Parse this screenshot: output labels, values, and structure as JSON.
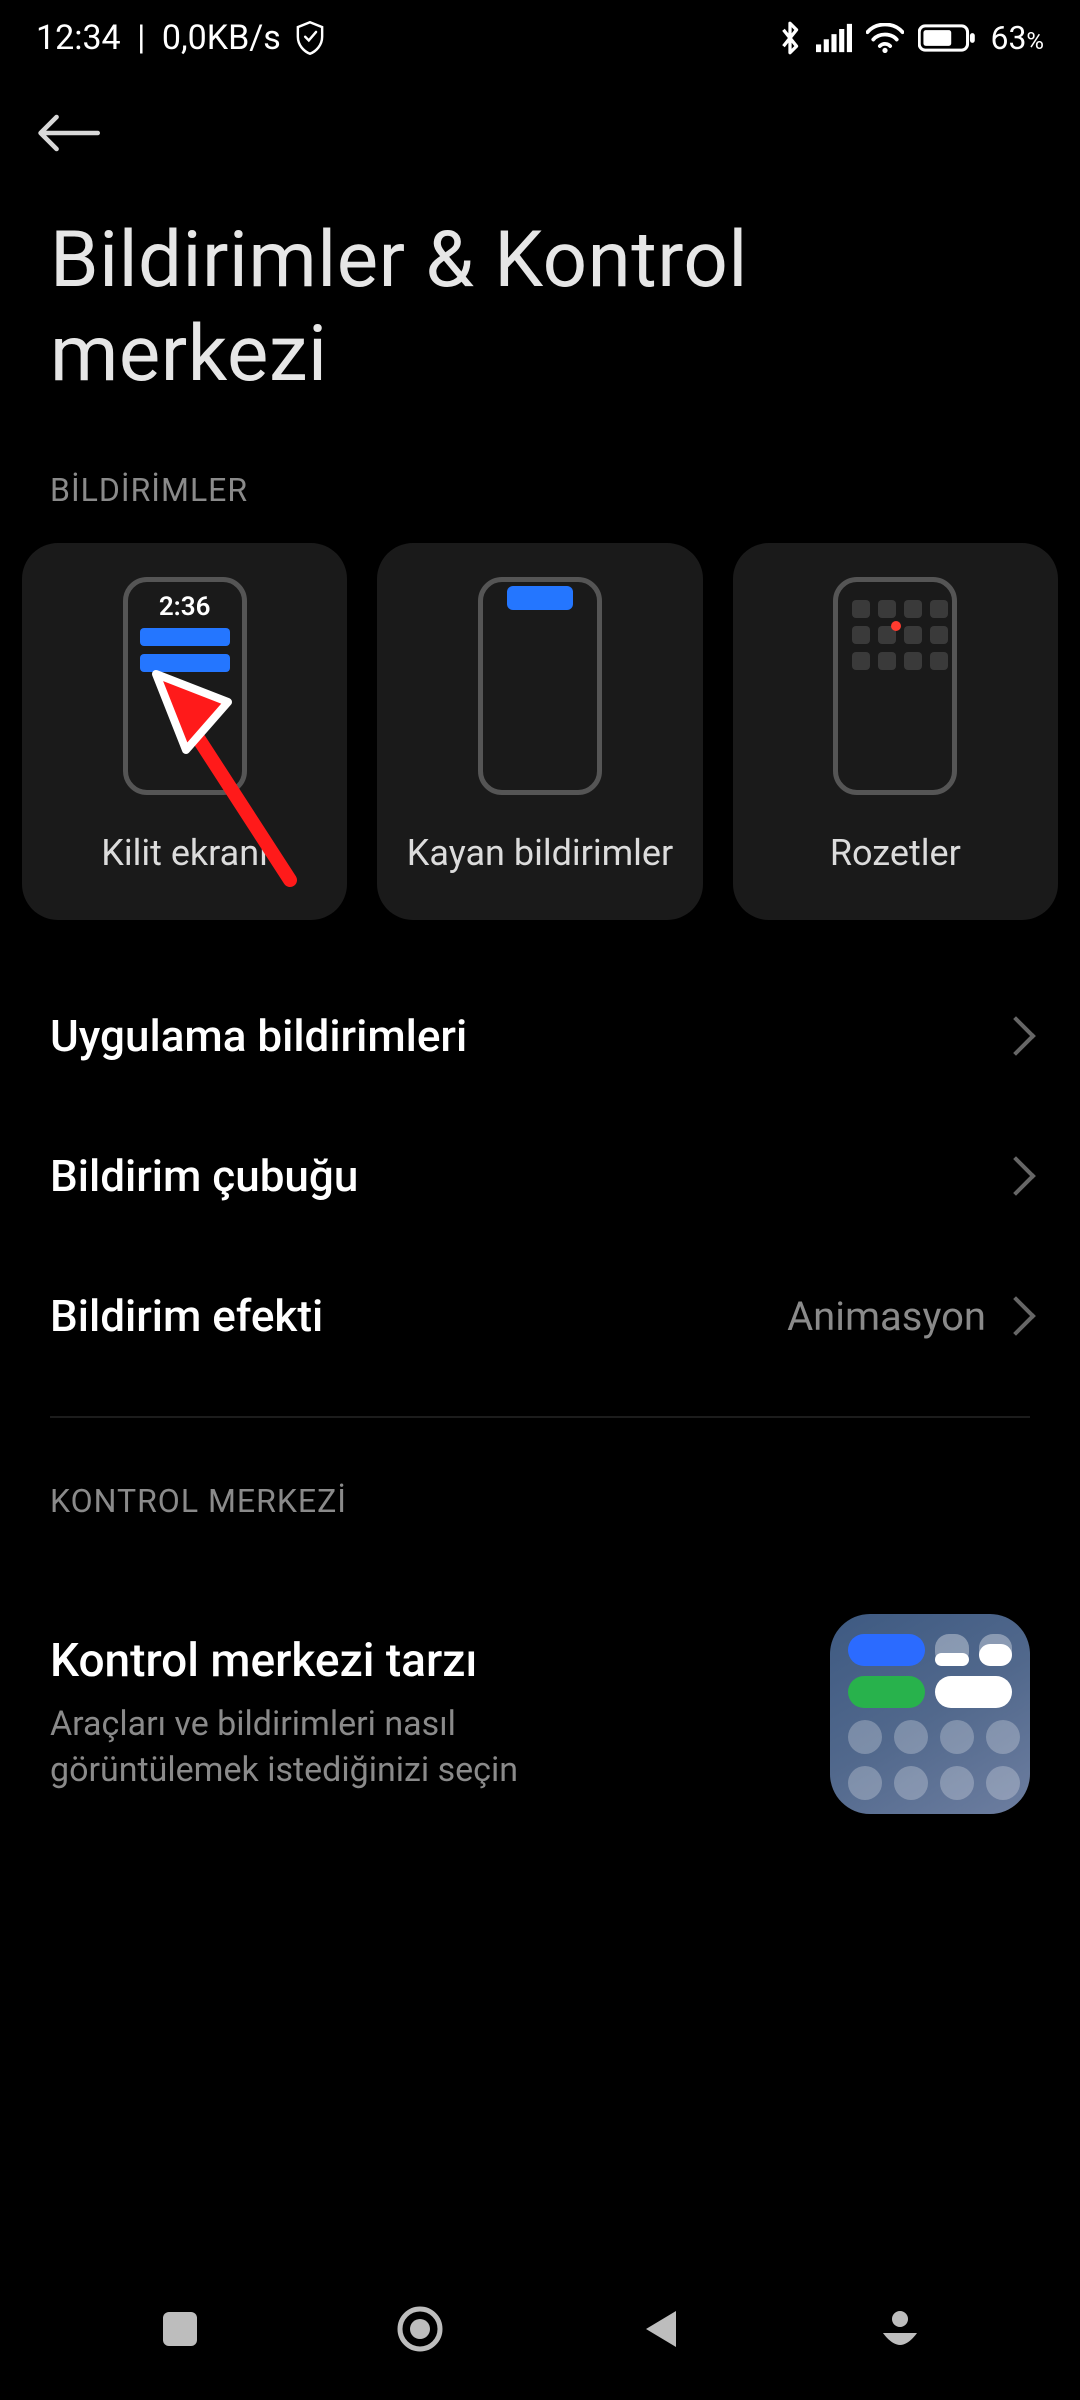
{
  "status": {
    "time": "12:34",
    "net_speed": "0,0KB/s",
    "battery_pct": "63",
    "battery_suffix": "%"
  },
  "header": {
    "title": "Bildirimler & Kontrol merkezi"
  },
  "sections": {
    "notifications_label": "BİLDİRİMLER",
    "control_center_label": "KONTROL MERKEZİ"
  },
  "cards": {
    "lock_screen": {
      "label": "Kilit ekranı",
      "clock": "2:36"
    },
    "floating": {
      "label": "Kayan bildirimler"
    },
    "badges": {
      "label": "Rozetler"
    }
  },
  "rows": {
    "app_notifications": {
      "title": "Uygulama bildirimleri"
    },
    "notification_bar": {
      "title": "Bildirim çubuğu"
    },
    "notification_effect": {
      "title": "Bildirim efekti",
      "value": "Animasyon"
    }
  },
  "control_center": {
    "title": "Kontrol merkezi tarzı",
    "desc": "Araçları ve bildirimleri nasıl görüntülemek istediğinizi seçin"
  },
  "overlay": {
    "arrow_visible": true
  }
}
